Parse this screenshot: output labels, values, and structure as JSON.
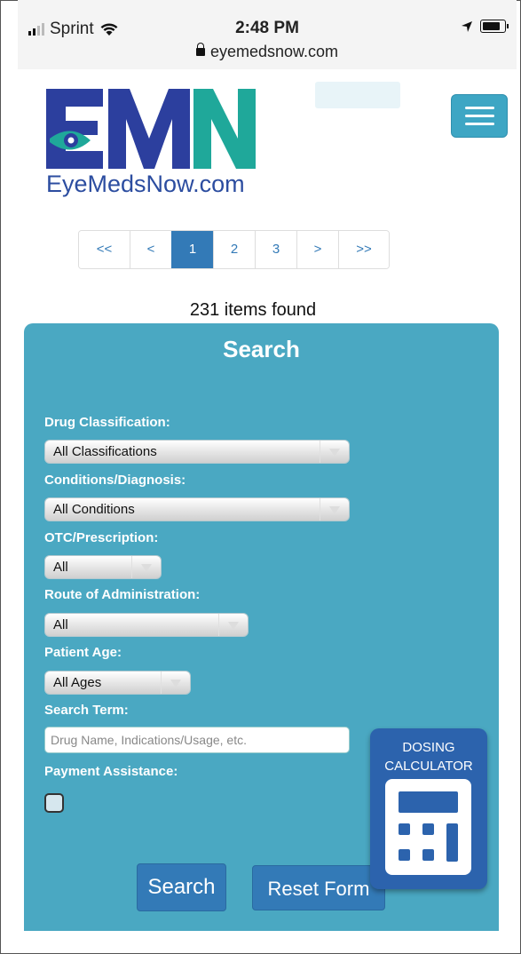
{
  "status_bar": {
    "carrier": "Sprint",
    "time": "2:48 PM",
    "url": "eyemedsnow.com"
  },
  "header": {
    "logo_letters": "EMN",
    "logo_text": "EyeMedsNow.com",
    "menu_icon": "hamburger-icon"
  },
  "pagination": {
    "pages": [
      "<<",
      "<",
      "1",
      "2",
      "3",
      ">",
      ">>"
    ],
    "active_page": "1"
  },
  "results": {
    "count_text": "231 items found"
  },
  "search": {
    "title": "Search",
    "drug_classification": {
      "label": "Drug Classification:",
      "value": "All Classifications"
    },
    "conditions": {
      "label": "Conditions/Diagnosis:",
      "value": "All Conditions"
    },
    "otc_prescription": {
      "label": "OTC/Prescription:",
      "value": "All"
    },
    "route": {
      "label": "Route of Administration:",
      "value": "All"
    },
    "patient_age": {
      "label": "Patient Age:",
      "value": "All Ages"
    },
    "search_term": {
      "label": "Search Term:",
      "placeholder": "Drug Name, Indications/Usage, etc."
    },
    "payment_assistance": {
      "label": "Payment Assistance:",
      "checked": false
    },
    "search_button": "Search",
    "reset_button": "Reset Form"
  },
  "dosing_calculator": {
    "line1": "DOSING",
    "line2": "CALCULATOR",
    "icon": "calculator-icon"
  },
  "colors": {
    "panel": "#4aa8c2",
    "primary": "#337ab7",
    "dosing": "#2c63ad",
    "logo_blue": "#2c3f9e",
    "logo_teal": "#1fa89a"
  }
}
